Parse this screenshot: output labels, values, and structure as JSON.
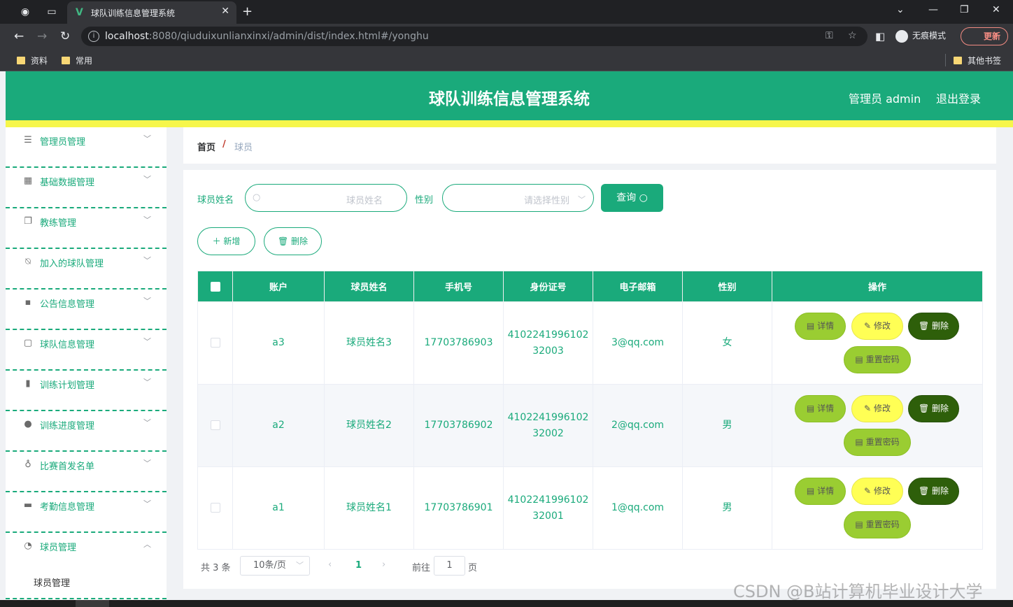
{
  "browser": {
    "tab_title": "球队训练信息管理系统",
    "url_host": "localhost",
    "url_rest": ":8080/qiuduixunlianxinxi/admin/dist/index.html#/yonghu",
    "incognito_label": "无痕模式",
    "update_label": "更新",
    "bookmarks": [
      "资料",
      "常用"
    ],
    "other_bookmarks": "其他书签"
  },
  "app": {
    "title": "球队训练信息管理系统",
    "user": "管理员 admin",
    "logout": "退出登录"
  },
  "sidebar": {
    "items": [
      {
        "label": "管理员管理",
        "icon": "list-icon",
        "expanded": false
      },
      {
        "label": "基础数据管理",
        "icon": "grid-icon",
        "expanded": false
      },
      {
        "label": "教练管理",
        "icon": "copy-icon",
        "expanded": false
      },
      {
        "label": "加入的球队管理",
        "icon": "bell-off-icon",
        "expanded": false
      },
      {
        "label": "公告信息管理",
        "icon": "message-icon",
        "expanded": false
      },
      {
        "label": "球队信息管理",
        "icon": "chat-icon",
        "expanded": false
      },
      {
        "label": "训练计划管理",
        "icon": "chart-icon",
        "expanded": false
      },
      {
        "label": "训练进度管理",
        "icon": "user-icon",
        "expanded": false
      },
      {
        "label": "比赛首发名单",
        "icon": "microphone-icon",
        "expanded": false
      },
      {
        "label": "考勤信息管理",
        "icon": "monitor-icon",
        "expanded": false
      },
      {
        "label": "球员管理",
        "icon": "dashboard-icon",
        "expanded": true
      }
    ],
    "sub_item": "球员管理"
  },
  "breadcrumb": {
    "home": "首页",
    "separator": "/",
    "current": "球员"
  },
  "search": {
    "name_label": "球员姓名",
    "name_placeholder": "球员姓名",
    "gender_label": "性别",
    "gender_placeholder": "请选择性别",
    "query_button": "查询"
  },
  "actions": {
    "add": "新增",
    "delete": "删除"
  },
  "table": {
    "columns": [
      "账户",
      "球员姓名",
      "手机号",
      "身份证号",
      "电子邮箱",
      "性别",
      "操作"
    ],
    "rows": [
      {
        "account": "a3",
        "name": "球员姓名3",
        "phone": "17703786903",
        "id_line1": "4102241996102",
        "id_line2": "32003",
        "email": "3@qq.com",
        "gender": "女"
      },
      {
        "account": "a2",
        "name": "球员姓名2",
        "phone": "17703786902",
        "id_line1": "4102241996102",
        "id_line2": "32002",
        "email": "2@qq.com",
        "gender": "男"
      },
      {
        "account": "a1",
        "name": "球员姓名1",
        "phone": "17703786901",
        "id_line1": "4102241996102",
        "id_line2": "32001",
        "email": "1@qq.com",
        "gender": "男"
      }
    ],
    "ops": {
      "detail": "详情",
      "edit": "修改",
      "delete": "删除",
      "reset_password": "重置密码"
    }
  },
  "pagination": {
    "total": "共 3 条",
    "page_size": "10条/页",
    "current_page": "1",
    "goto_label": "前往",
    "goto_value": "1",
    "page_suffix": "页"
  },
  "watermark": "CSDN @B站计算机毕业设计大学",
  "colors": {
    "primary": "#1aaa7b",
    "accent_yellow": "#f6f64b",
    "detail_button": "#9acd32",
    "edit_button": "#ffff55",
    "delete_button": "#2e5f0a"
  }
}
